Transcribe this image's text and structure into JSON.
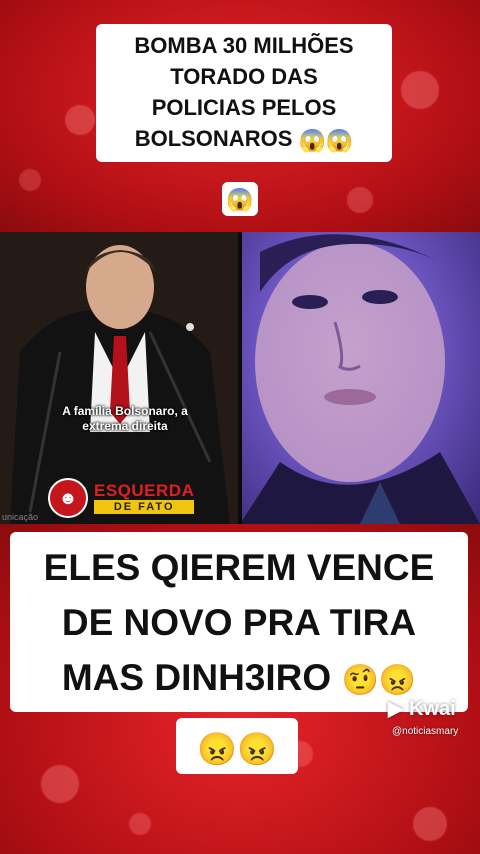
{
  "top_caption": {
    "line1": "BOMBA 30 MILHÕES",
    "line2": "TORADO DAS",
    "line3": "POLICIAS PELOS",
    "line4": "BOLSONAROS",
    "emojis": "😱😱",
    "extra_emoji": "😱"
  },
  "left_video": {
    "subtitle": "A família Bolsonaro, a extrema direita",
    "brand_line1": "ESQUERDA",
    "brand_line2": "DE FATO",
    "credit": "unicação"
  },
  "bottom_caption": {
    "line1": "ELES QIEREM VENCE",
    "line2": "DE NOVO PRA TIRA",
    "line3": "MAS DINH3IRO",
    "line3_emojis": "🤨😠",
    "line4_emojis": "😠😠"
  },
  "watermark": {
    "brand": "Kwai",
    "handle": "@noticiasmary"
  },
  "colors": {
    "background": "#c4161c",
    "brand_red": "#e02020",
    "brand_yellow": "#f1c40f"
  }
}
